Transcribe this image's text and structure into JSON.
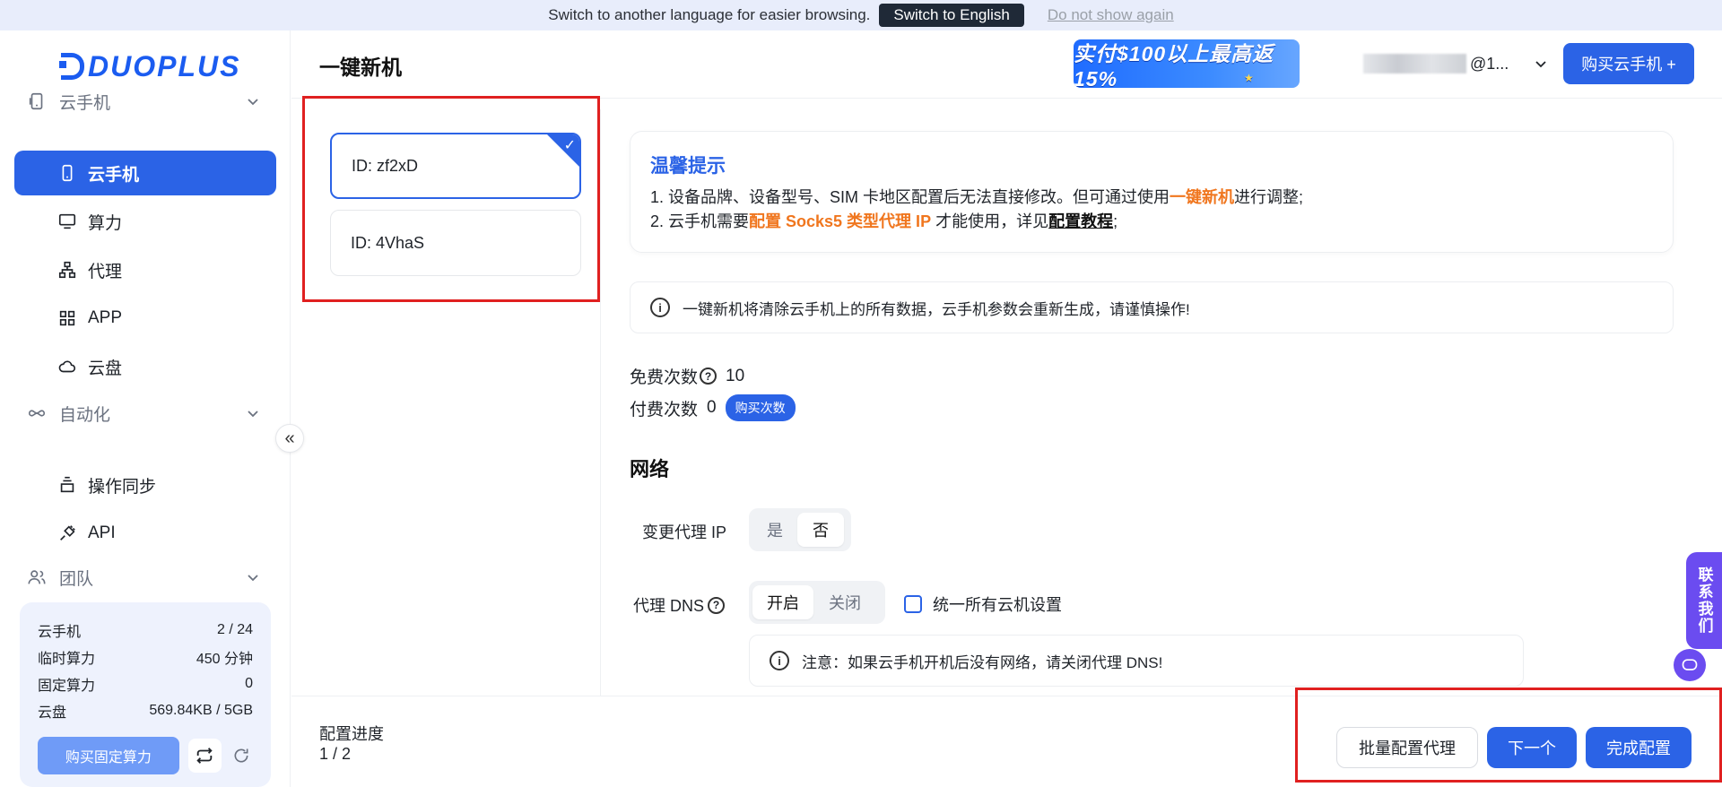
{
  "banner": {
    "text": "Switch to another language for easier browsing.",
    "switch_label": "Switch to English",
    "dismiss_label": "Do not show again"
  },
  "sidebar": {
    "logo": "DUOPLUS",
    "groups": [
      {
        "label": "云手机",
        "items": [
          {
            "label": "云手机"
          },
          {
            "label": "算力"
          },
          {
            "label": "代理"
          },
          {
            "label": "APP"
          },
          {
            "label": "云盘"
          }
        ]
      },
      {
        "label": "自动化",
        "items": [
          {
            "label": "操作同步"
          },
          {
            "label": "API"
          }
        ]
      },
      {
        "label": "团队"
      }
    ],
    "stats": [
      {
        "label": "云手机",
        "value": "2 / 24"
      },
      {
        "label": "临时算力",
        "value": "450 分钟"
      },
      {
        "label": "固定算力",
        "value": "0"
      },
      {
        "label": "云盘",
        "value": "569.84KB / 5GB"
      }
    ],
    "buy_fixed_label": "购买固定算力"
  },
  "header": {
    "title": "一键新机",
    "promo": "实付$100以上最高返15%",
    "user_suffix": "@1...",
    "buy_label": "购买云手机 +"
  },
  "devices": [
    {
      "label": "ID: zf2xD",
      "selected": true
    },
    {
      "label": "ID: 4VhaS",
      "selected": false
    }
  ],
  "tip": {
    "title": "温馨提示",
    "line1_a": "1. 设备品牌、设备型号、SIM 卡地区配置后无法直接修改。但可通过使用",
    "line1_hl": "一键新机",
    "line1_b": "进行调整;",
    "line2_a": "2. 云手机需要",
    "line2_hl": "配置 Socks5 类型代理 IP",
    "line2_b": " 才能使用，详见",
    "line2_link": "配置教程",
    "line2_c": ";"
  },
  "warning": "一键新机将清除云手机上的所有数据，云手机参数会重新生成，请谨慎操作!",
  "counts": {
    "free_label": "免费次数",
    "free_value": "10",
    "paid_label": "付费次数",
    "paid_value": "0",
    "buy_label": "购买次数"
  },
  "network": {
    "title": "网络",
    "change_ip_label": "变更代理 IP",
    "change_ip_options": [
      "是",
      "否"
    ],
    "change_ip_selected": "否",
    "dns_label": "代理 DNS",
    "dns_options": [
      "开启",
      "关闭"
    ],
    "dns_selected": "开启",
    "unify_label": "统一所有云机设置",
    "note": "注意：如果云手机开机后没有网络，请关闭代理 DNS!"
  },
  "footer": {
    "progress_label": "配置进度",
    "progress_value": "1 / 2",
    "batch_label": "批量配置代理",
    "next_label": "下一个",
    "finish_label": "完成配置"
  },
  "contact_label": "联系我们",
  "colors": {
    "accent": "#2b63e6",
    "highlight": "#f0761e",
    "annotation": "#e02020",
    "contact": "#6b4cf0"
  }
}
